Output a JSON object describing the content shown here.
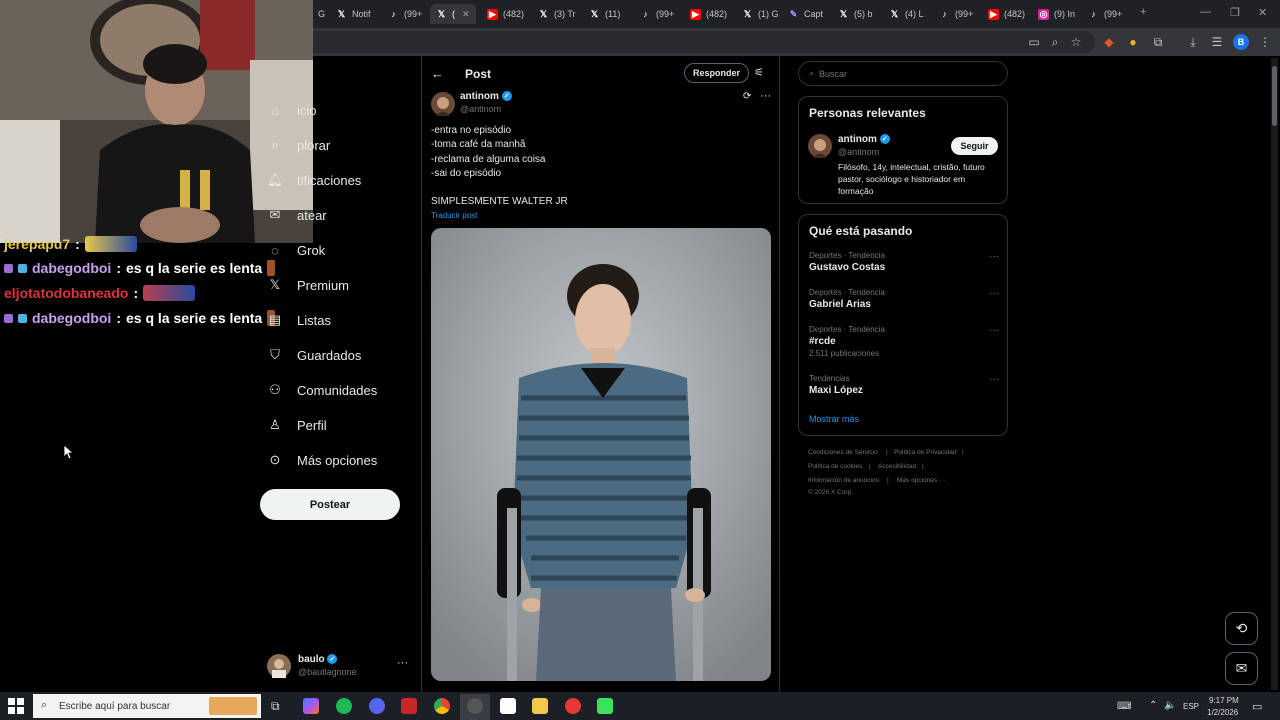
{
  "browser": {
    "tabs": [
      {
        "label": "G",
        "icon": "x-logo-icon"
      },
      {
        "label": "Notif",
        "icon": "x-logo-icon"
      },
      {
        "label": "(99+",
        "icon": "tiktok-icon"
      },
      {
        "label": "(",
        "icon": "x-logo-icon",
        "active": true
      },
      {
        "label": "(482)",
        "icon": "youtube-icon"
      },
      {
        "label": "(3) Tr",
        "icon": "x-logo-icon"
      },
      {
        "label": "(11)",
        "icon": "x-logo-icon"
      },
      {
        "label": "(99+",
        "icon": "tiktok-icon"
      },
      {
        "label": "(482)",
        "icon": "youtube-icon"
      },
      {
        "label": "(1) G",
        "icon": "x-logo-icon"
      },
      {
        "label": "Capt",
        "icon": "pen-icon"
      },
      {
        "label": "(5) b",
        "icon": "x-logo-icon"
      },
      {
        "label": "(4) L",
        "icon": "x-logo-icon"
      },
      {
        "label": "(99+",
        "icon": "tiktok-icon"
      },
      {
        "label": "(482)",
        "icon": "youtube-icon"
      },
      {
        "label": "(9) In",
        "icon": "instagram-icon"
      },
      {
        "label": "(99+",
        "icon": "tiktok-icon"
      }
    ],
    "profile_initial": "B"
  },
  "chat": [
    {
      "user": "jerepapu7",
      "message": "",
      "color": "#e6c84a"
    },
    {
      "user": "dabegodboi",
      "message": "es q la serie es lenta",
      "color": "#c8a2f0"
    },
    {
      "user": "eljotatodobaneado",
      "message": "",
      "color": "#e0313f"
    },
    {
      "user": "dabegodboi",
      "message": "es q la serie es lenta",
      "color": "#c8a2f0"
    }
  ],
  "nav": {
    "items": [
      {
        "label": "icio",
        "icon": "home-icon"
      },
      {
        "label": "plorar",
        "icon": "search-icon"
      },
      {
        "label": "tificaciones",
        "icon": "bell-icon"
      },
      {
        "label": "atear",
        "icon": "mail-icon"
      },
      {
        "label": "Grok",
        "icon": "grok-icon"
      },
      {
        "label": "Premium",
        "icon": "x-logo-icon"
      },
      {
        "label": "Listas",
        "icon": "list-icon"
      },
      {
        "label": "Guardados",
        "icon": "bookmark-icon"
      },
      {
        "label": "Comunidades",
        "icon": "communities-icon"
      },
      {
        "label": "Perfil",
        "icon": "person-icon"
      },
      {
        "label": "Más opciones",
        "icon": "more-circle-icon"
      }
    ],
    "post_button": "Postear",
    "account": {
      "name": "baulo",
      "handle": "@bautlagnone"
    }
  },
  "post": {
    "header_title": "Post",
    "reply_button": "Responder",
    "author_name": "antinom",
    "author_handle": "@antinom",
    "lines": [
      "-entra no episódio",
      "-toma café da manhã",
      "-reclama de alguma coisa",
      "-sai do episódio"
    ],
    "caption": "SIMPLESMENTE WALTER JR",
    "translate": "Traducir post"
  },
  "right": {
    "search_placeholder": "Buscar",
    "relevant": {
      "title": "Personas relevantes",
      "name": "antinom",
      "handle": "@antinom",
      "follow": "Seguir",
      "bio": "Filósofo, 14y, intelectual, cristão, futuro pastor, sociólogo e historiador em formação"
    },
    "trends": {
      "title": "Qué está pasando",
      "items": [
        {
          "category": "Deportes · Tendencia",
          "name": "Gustavo Costas",
          "count": ""
        },
        {
          "category": "Deportes · Tendencia",
          "name": "Gabriel Arias",
          "count": ""
        },
        {
          "category": "Deportes · Tendencia",
          "name": "#rcde",
          "count": "2.511 publicaciones"
        },
        {
          "category": "Tendencias",
          "name": "Maxi López",
          "count": ""
        }
      ],
      "more": "Mostrar más"
    },
    "footer": {
      "terms": "Condiciones de Servicio",
      "privacy": "Política de Privacidad",
      "cookies": "Política de cookies",
      "accessibility": "Accesibilidad",
      "ads": "Información de anuncios",
      "more": "Más opciones ···",
      "copyright": "© 2026 X Corp."
    }
  },
  "taskbar": {
    "search_placeholder": "Escribe aquí para buscar",
    "lang": "ESP",
    "time": "9:17 PM",
    "date": "1/2/2026"
  }
}
